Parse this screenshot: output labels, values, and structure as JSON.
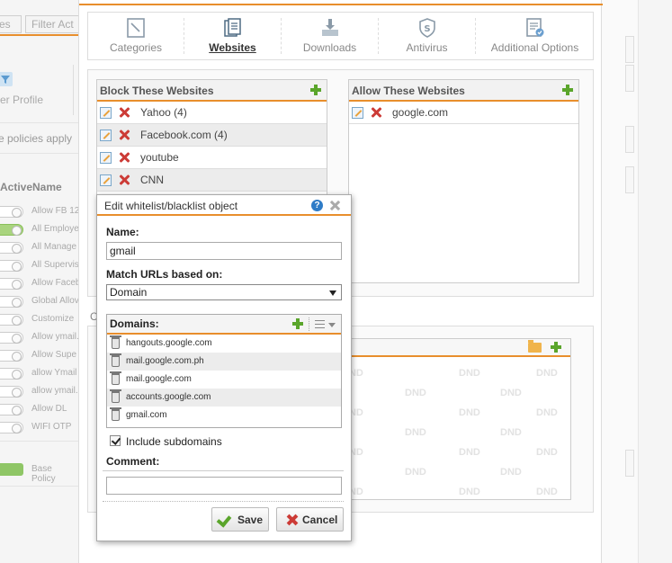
{
  "background": {
    "tabs": [
      "es",
      "Filter Act"
    ],
    "filter_profile_label": "lter Profile",
    "policies_text": "e policies apply",
    "columns": {
      "active": "Active",
      "name": "Name"
    },
    "rows": [
      {
        "name": "Allow FB 12",
        "on": false
      },
      {
        "name": "All Employe",
        "on": true
      },
      {
        "name": "All Manage",
        "on": false
      },
      {
        "name": "All Supervis",
        "on": false
      },
      {
        "name": "Allow Faceb",
        "on": false
      },
      {
        "name": "Global Allov",
        "on": false
      },
      {
        "name": "Customize",
        "on": false
      },
      {
        "name": "Allow ymail.",
        "on": false
      },
      {
        "name": "Allow Supe",
        "on": false
      },
      {
        "name": "allow Ymail",
        "on": false
      },
      {
        "name": "allow ymail.",
        "on": false
      },
      {
        "name": "Allow DL",
        "on": false
      },
      {
        "name": "WIFI OTP",
        "on": false
      }
    ],
    "base_policy": "Base Policy"
  },
  "tabs": [
    {
      "label": "Categories",
      "icon": "categories-icon",
      "active": false
    },
    {
      "label": "Websites",
      "icon": "websites-icon",
      "active": true
    },
    {
      "label": "Downloads",
      "icon": "downloads-icon",
      "active": false
    },
    {
      "label": "Antivirus",
      "icon": "antivirus-icon",
      "active": false
    },
    {
      "label": "Additional Options",
      "icon": "additional-options-icon",
      "active": false
    }
  ],
  "block_list": {
    "title": "Block These Websites",
    "items": [
      "Yahoo (4)",
      "Facebook.com (4)",
      "youtube",
      "CNN"
    ]
  },
  "allow_list": {
    "title": "Allow These Websites",
    "items": [
      "google.com"
    ]
  },
  "lower_label": "C",
  "dnd_label": "DND",
  "dialog": {
    "title": "Edit whitelist/blacklist object",
    "help": "?",
    "name_label": "Name:",
    "name_value": "gmail",
    "match_label": "Match URLs based on:",
    "match_value": "Domain",
    "domains_label": "Domains:",
    "domains": [
      "hangouts.google.com",
      "mail.google.com.ph",
      "mail.google.com",
      "accounts.google.com",
      "gmail.com"
    ],
    "include_subdomains": "Include subdomains",
    "comment_label": "Comment:",
    "comment_value": "",
    "save_label": "Save",
    "cancel_label": "Cancel"
  },
  "colors": {
    "accent": "#e88e2c",
    "add_green": "#5aa52b",
    "delete_red": "#cc3b36",
    "help_blue": "#2f7cc7"
  }
}
